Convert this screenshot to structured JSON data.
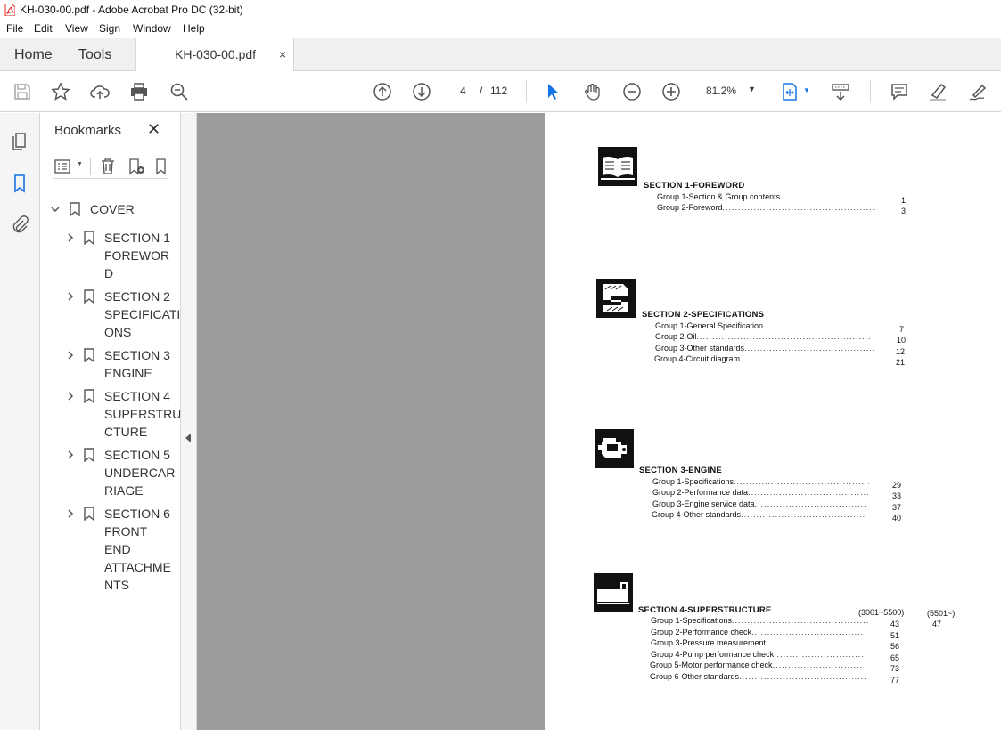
{
  "window": {
    "title": "KH-030-00.pdf - Adobe Acrobat Pro DC (32-bit)"
  },
  "menu": [
    "File",
    "Edit",
    "View",
    "Sign",
    "Window",
    "Help"
  ],
  "tabs": {
    "home": "Home",
    "tools": "Tools",
    "document": "KH-030-00.pdf",
    "close": "×"
  },
  "toolbar": {
    "current_page": "4",
    "separator": "/",
    "total_pages": "112",
    "zoom": "81.2%",
    "icons": [
      "save-icon",
      "star-icon",
      "upload-icon",
      "print-icon",
      "zoom-out-search-icon",
      "page-up-icon",
      "page-down-icon",
      "select-cursor-icon",
      "hand-icon",
      "zoom-minus-icon",
      "zoom-plus-icon",
      "fit-page-icon",
      "scroll-mode-icon",
      "comment-icon",
      "highlight-icon",
      "sign-icon"
    ]
  },
  "bookmarks": {
    "title": "Bookmarks",
    "close": "✕",
    "root": {
      "label": "COVER"
    },
    "items": [
      {
        "label": "SECTION 1\nFOREWOR\nD"
      },
      {
        "label": "SECTION 2\nSPECIFICATI\nONS"
      },
      {
        "label": "SECTION 3\nENGINE"
      },
      {
        "label": "SECTION 4\nSUPERSTRU\nCTURE"
      },
      {
        "label": "SECTION 5\nUNDERCAR\nRIAGE"
      },
      {
        "label": "SECTION 6\nFRONT\nEND\nATTACHME\nNTS"
      }
    ]
  },
  "document": {
    "sections": [
      {
        "title": "SECTION  1-FOREWORD",
        "icon": "book-icon",
        "groups": [
          {
            "label": "Group 1-Section & Group contents",
            "page": "1"
          },
          {
            "label": "Group 2-Foreword",
            "page": "3"
          }
        ]
      },
      {
        "title": "SECTION  2-SPECIFICATIONS",
        "icon": "spec-icon",
        "groups": [
          {
            "label": "Group 1-General Specification",
            "page": "7"
          },
          {
            "label": "Group 2-Oil",
            "page": "10"
          },
          {
            "label": "Group 3-Other standards",
            "page": "12"
          },
          {
            "label": "Group 4-Circuit diagram",
            "page": "21"
          }
        ]
      },
      {
        "title": "SECTION  3-ENGINE",
        "icon": "engine-icon",
        "groups": [
          {
            "label": "Group 1-Specifications",
            "page": "29"
          },
          {
            "label": "Group 2-Performance data",
            "page": "33"
          },
          {
            "label": "Group 3-Engine service data",
            "page": "37"
          },
          {
            "label": "Group 4-Other standards",
            "page": "40"
          }
        ]
      },
      {
        "title": "SECTION  4-SUPERSTRUCTURE",
        "icon": "superstructure-icon",
        "col_a": "(3001~5500)",
        "col_b": "(5501~)",
        "groups": [
          {
            "label": "Group 1-Specifications",
            "page": "43",
            "page_b": "47"
          },
          {
            "label": "Group 2-Performance check",
            "page": "51"
          },
          {
            "label": "Group 3-Pressure measurement",
            "page": "56"
          },
          {
            "label": "Group 4-Pump performance check",
            "page": "65"
          },
          {
            "label": "Group 5-Motor performance check",
            "page": "73"
          },
          {
            "label": "Group 6-Other standards",
            "page": "77"
          }
        ]
      }
    ]
  },
  "colors": {
    "accent": "#1473e6",
    "pdf_red": "#e0261b",
    "doc_gray": "#9c9c9c"
  }
}
